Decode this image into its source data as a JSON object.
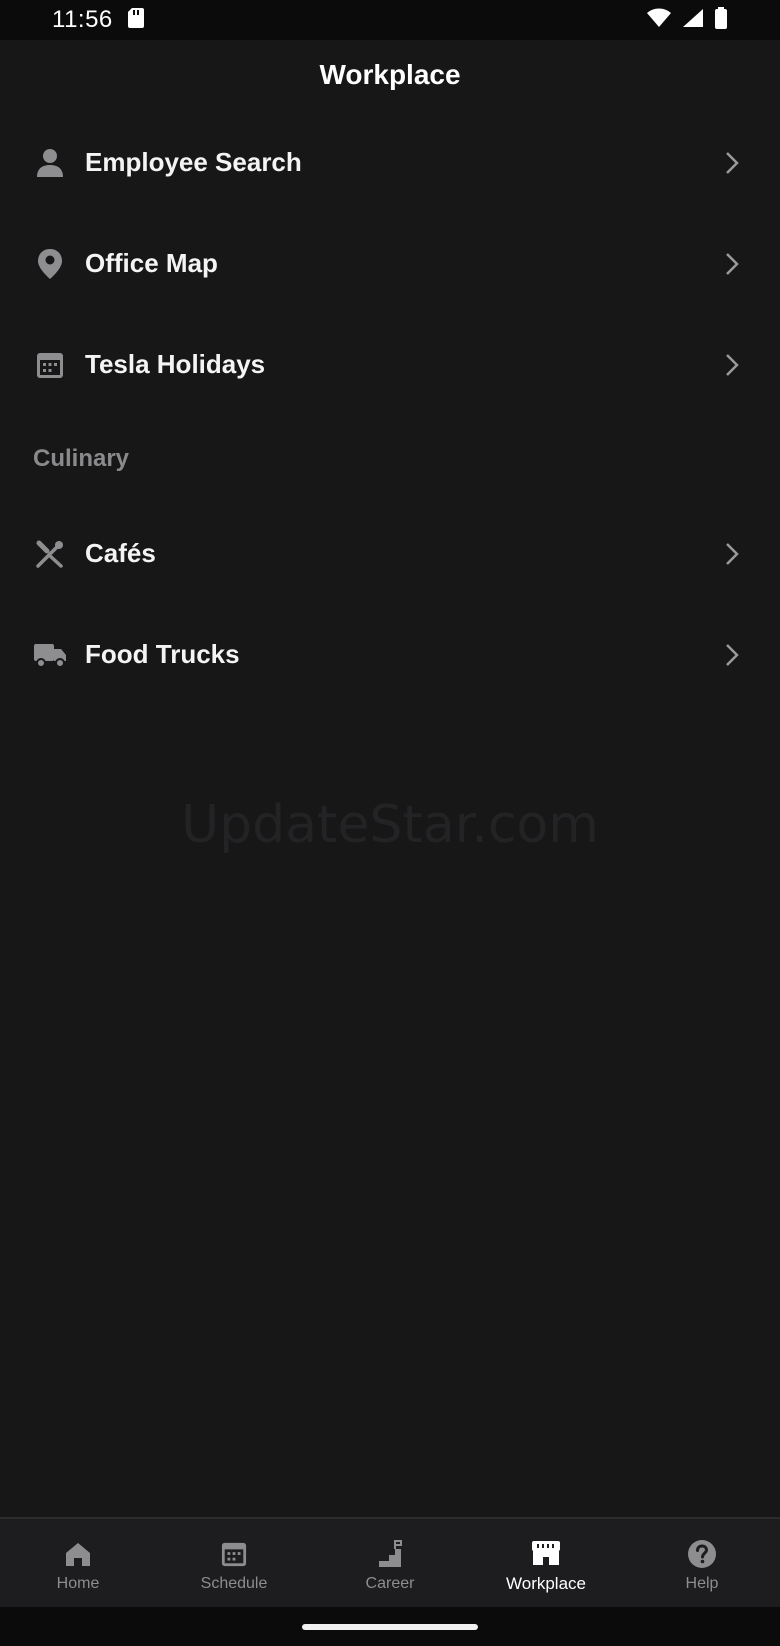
{
  "status_bar": {
    "time": "11:56"
  },
  "header": {
    "title": "Workplace"
  },
  "menu": {
    "items": [
      {
        "label": "Employee Search",
        "icon": "person-icon"
      },
      {
        "label": "Office Map",
        "icon": "location-pin-icon"
      },
      {
        "label": "Tesla Holidays",
        "icon": "calendar-icon"
      }
    ],
    "culinary_section": {
      "label": "Culinary",
      "items": [
        {
          "label": "Cafés",
          "icon": "fork-knife-icon"
        },
        {
          "label": "Food Trucks",
          "icon": "truck-icon"
        }
      ]
    }
  },
  "watermark": "UpdateStar.com",
  "bottom_nav": {
    "items": [
      {
        "label": "Home",
        "icon": "home-icon"
      },
      {
        "label": "Schedule",
        "icon": "calendar-icon"
      },
      {
        "label": "Career",
        "icon": "stairs-flag-icon"
      },
      {
        "label": "Workplace",
        "icon": "store-icon",
        "active": true
      },
      {
        "label": "Help",
        "icon": "help-circle-icon"
      }
    ]
  },
  "colors": {
    "background": "#171718",
    "text_primary": "#ffffff",
    "text_secondary": "#8a8a8c",
    "icon_gray": "#8e8e90",
    "nav_background": "#1d1d1f"
  }
}
